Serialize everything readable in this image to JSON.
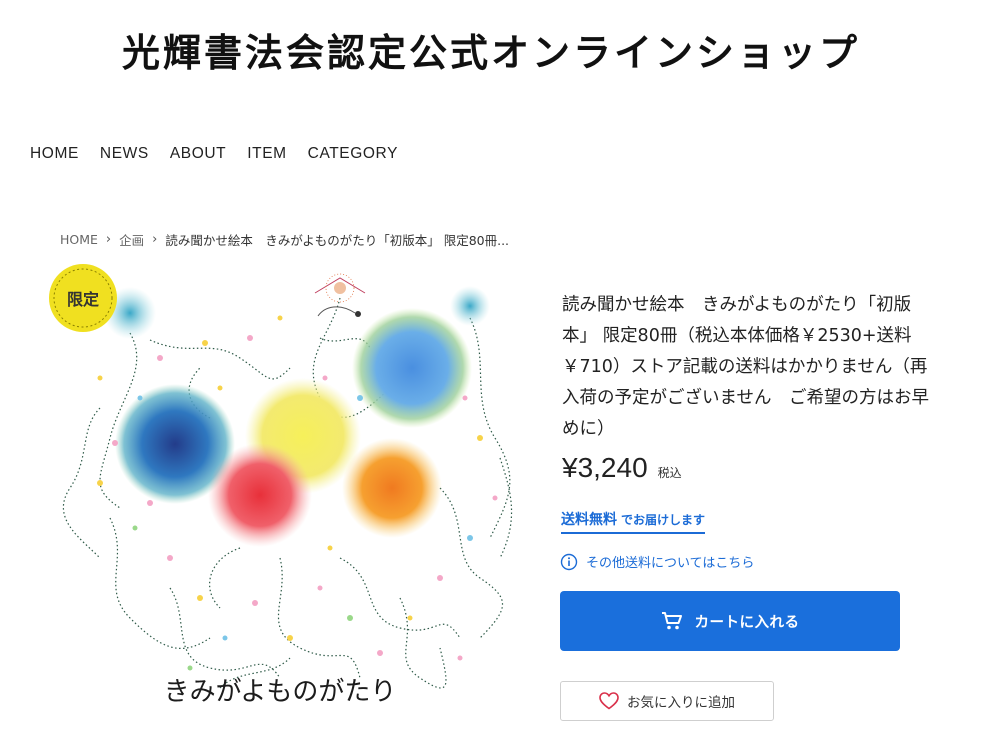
{
  "header": {
    "title": "光輝書法会認定公式オンラインショップ"
  },
  "nav": {
    "items": [
      "HOME",
      "NEWS",
      "ABOUT",
      "ITEM",
      "CATEGORY"
    ]
  },
  "breadcrumb": {
    "home": "HOME",
    "category": "企画",
    "current": "読み聞かせ絵本　きみがよものがたり「初版本」 限定80冊..."
  },
  "product": {
    "badge": "限定",
    "image_caption": "きみがよものがたり",
    "title": "読み聞かせ絵本　きみがよものがたり「初版本」 限定80冊（税込本体価格￥2530+送料￥710）ストア記載の送料はかかりません（再入荷の予定がございません　ご希望の方はお早めに）",
    "price": "¥3,240",
    "tax_label": "税込",
    "shipping_free_strong": "送料無料",
    "shipping_free_rest": "でお届けします",
    "shipping_info": "その他送料についてはこちら",
    "cart_button": "カートに入れる",
    "favorite_button": "お気に入りに追加"
  },
  "colors": {
    "accent": "#1a6fdc",
    "badge": "#f0e020"
  },
  "icons": {
    "cart": "cart-icon",
    "info": "info-icon",
    "heart": "heart-icon"
  }
}
